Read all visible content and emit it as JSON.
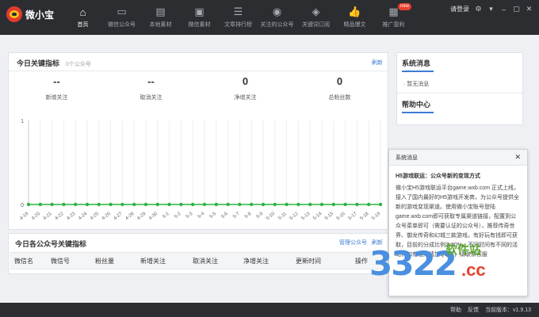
{
  "app": {
    "name": "微小宝"
  },
  "nav": [
    {
      "label": "首页",
      "icon": "home-icon"
    },
    {
      "label": "微信公众号",
      "icon": "monitor-icon"
    },
    {
      "label": "本地素材",
      "icon": "folder-icon"
    },
    {
      "label": "微信素材",
      "icon": "image-icon"
    },
    {
      "label": "文章排行榜",
      "icon": "list-icon"
    },
    {
      "label": "关注的公众号",
      "icon": "chat-icon"
    },
    {
      "label": "关键词订阅",
      "icon": "shield-icon"
    },
    {
      "label": "精品爆文",
      "icon": "thumbs-up-icon"
    },
    {
      "label": "推广盈利",
      "icon": "card-icon",
      "badge": "new"
    }
  ],
  "topright": {
    "login": "请登录"
  },
  "overview": {
    "title": "今日关键指标",
    "subtitle": "0个公众号",
    "refresh": "刷新",
    "stats": [
      {
        "value": "--",
        "label": "新增关注"
      },
      {
        "value": "--",
        "label": "取消关注"
      },
      {
        "value": "0",
        "label": "净增关注"
      },
      {
        "value": "0",
        "label": "总粉丝数"
      }
    ]
  },
  "chart_data": {
    "type": "line",
    "categories": [
      "4-19",
      "4-20",
      "4-21",
      "4-22",
      "4-23",
      "4-24",
      "4-25",
      "4-26",
      "4-27",
      "4-28",
      "4-29",
      "4-30",
      "5-1",
      "5-2",
      "5-3",
      "5-4",
      "5-5",
      "5-6",
      "5-7",
      "5-8",
      "5-9",
      "5-10",
      "5-11",
      "5-12",
      "5-13",
      "5-14",
      "5-15",
      "5-16",
      "5-17",
      "5-18",
      "5-19"
    ],
    "values": [
      0,
      0,
      0,
      0,
      0,
      0,
      0,
      0,
      0,
      0,
      0,
      0,
      0,
      0,
      0,
      0,
      0,
      0,
      0,
      0,
      0,
      0,
      0,
      0,
      0,
      0,
      0,
      0,
      0,
      0,
      0
    ],
    "ylim": [
      0,
      1
    ],
    "yticks": [
      "0",
      "1"
    ],
    "grid": true,
    "color": "#2fb344"
  },
  "table": {
    "title": "今日各公众号关键指标",
    "manage": "管理公众号",
    "refresh": "刷新",
    "columns": [
      "微信名",
      "微信号",
      "粉丝量",
      "新增关注",
      "取消关注",
      "净增关注",
      "更新时间",
      "操作"
    ]
  },
  "side": {
    "news_title": "系统消息",
    "news_item": "· 暂无消息",
    "help_title": "帮助中心"
  },
  "popup": {
    "title": "系统消息",
    "heading": "H5游戏联运：公众号新的变现方式",
    "body": "微小宝H5游戏联运平台game.wxb.com 正式上线，接入了国内最好的H5游戏开发商，为公众号提供全新的游戏变现渠道。使用微小宝账号登陆game.wxb.com即可获取专属渠道链接，配置到公众号菜单即可（需要认证的公众号），推荐传奇世界、御龙传奇和幻城三款游戏，有好玩有钱即可获取，目前的分成比例为80%，不同时间有不同的活动，如有疑问请加QQ群，请联系客服"
  },
  "watermark": {
    "num": "3322",
    "sub": "软件站",
    "cc": ".cc"
  },
  "footer": {
    "help": "帮助",
    "feedback": "反馈",
    "version": "当前版本：v1.9.13"
  }
}
